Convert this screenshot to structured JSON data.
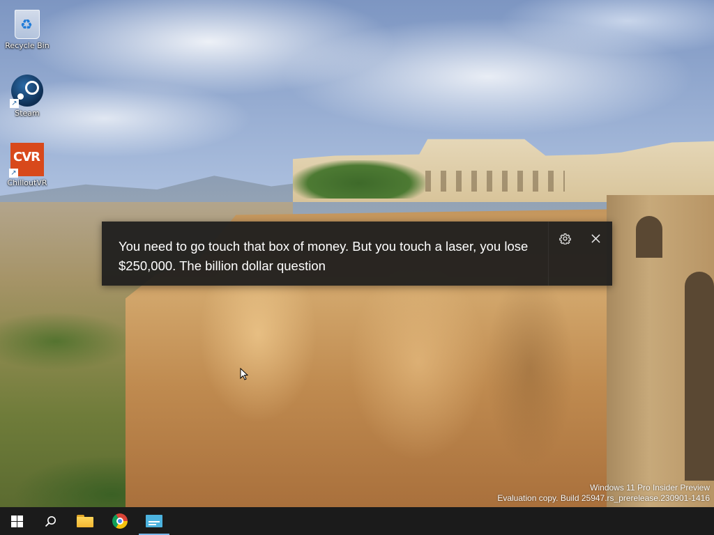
{
  "desktop": {
    "icons": [
      {
        "label": "Recycle Bin",
        "icon": "recycle-bin-icon"
      },
      {
        "label": "Steam",
        "icon": "steam-icon"
      },
      {
        "label": "ChilloutVR",
        "icon": "chilloutvr-icon"
      }
    ]
  },
  "live_captions": {
    "text": "You need to go touch that box of money. But you touch a laser, you lose $250,000. The billion dollar question",
    "settings_icon": "gear-icon",
    "close_icon": "close-icon",
    "background_color": "#1c1c1c"
  },
  "watermark": {
    "line1": "Windows 11 Pro Insider Preview",
    "line2": "Evaluation copy. Build 25947.rs_prerelease.230901-1416"
  },
  "taskbar": {
    "items": [
      {
        "name": "Start",
        "icon": "windows-logo-icon"
      },
      {
        "name": "Search",
        "icon": "search-icon"
      },
      {
        "name": "File Explorer",
        "icon": "folder-icon"
      },
      {
        "name": "Google Chrome",
        "icon": "chrome-icon"
      },
      {
        "name": "Live captions",
        "icon": "live-captions-icon",
        "active": true
      }
    ],
    "background_color": "#1b1b1b",
    "accent_color": "#7ab7ea"
  }
}
